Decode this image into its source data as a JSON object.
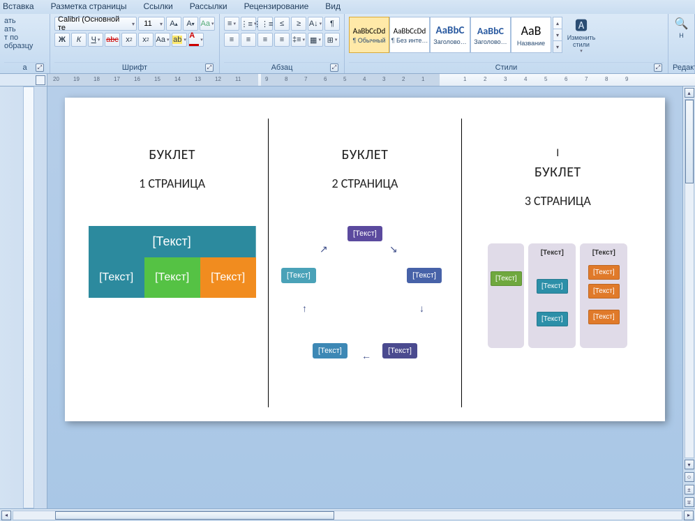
{
  "menu": {
    "items": [
      "Вставка",
      "Разметка страницы",
      "Ссылки",
      "Рассылки",
      "Рецензирование",
      "Вид"
    ]
  },
  "clipboard": {
    "paste": "ать",
    "copy": "ать",
    "format_painter": "т по образцу",
    "label_fragment": "а"
  },
  "font": {
    "family": "Calibri (Основной те",
    "size": "11",
    "label": "Шрифт"
  },
  "paragraph": {
    "label": "Абзац"
  },
  "styles": {
    "label": "Стили",
    "items": [
      {
        "preview": "AaBbCcDd",
        "label": "¶ Обычный",
        "selected": true,
        "size": "11px",
        "color": "#000",
        "weight": "400"
      },
      {
        "preview": "AaBbCcDd",
        "label": "¶ Без инте…",
        "selected": false,
        "size": "11px",
        "color": "#000",
        "weight": "400"
      },
      {
        "preview": "AaBbC",
        "label": "Заголово…",
        "selected": false,
        "size": "15px",
        "color": "#2a5aa0",
        "weight": "700"
      },
      {
        "preview": "AaBbC",
        "label": "Заголово…",
        "selected": false,
        "size": "14px",
        "color": "#2a5aa0",
        "weight": "700"
      },
      {
        "preview": "АаВ",
        "label": "Название",
        "selected": false,
        "size": "18px",
        "color": "#000",
        "weight": "400"
      }
    ],
    "change": "Изменить стили"
  },
  "editing": {
    "find_fragment": "Н",
    "label": "Редакт"
  },
  "ruler": {
    "numbers_left": [
      "20",
      "19",
      "18",
      "17",
      "16",
      "15",
      "14",
      "13",
      "12",
      "11"
    ],
    "numbers_center": [
      "9",
      "8",
      "7",
      "6",
      "5",
      "4",
      "3",
      "2",
      "1"
    ],
    "numbers_right": [
      "1",
      "2",
      "3",
      "4",
      "5",
      "6",
      "7",
      "8",
      "9"
    ]
  },
  "document": {
    "panel1": {
      "title": "БУКЛЕТ",
      "sub": "1 СТРАНИЦА",
      "ph": "[Текст]"
    },
    "panel2": {
      "title": "БУКЛЕТ",
      "sub": "2 СТРАНИЦА",
      "ph": "[Текст]"
    },
    "panel3": {
      "pre": "I",
      "title": "БУКЛЕТ",
      "sub": "3 СТРАНИЦА",
      "ph": "[Текст]"
    }
  }
}
